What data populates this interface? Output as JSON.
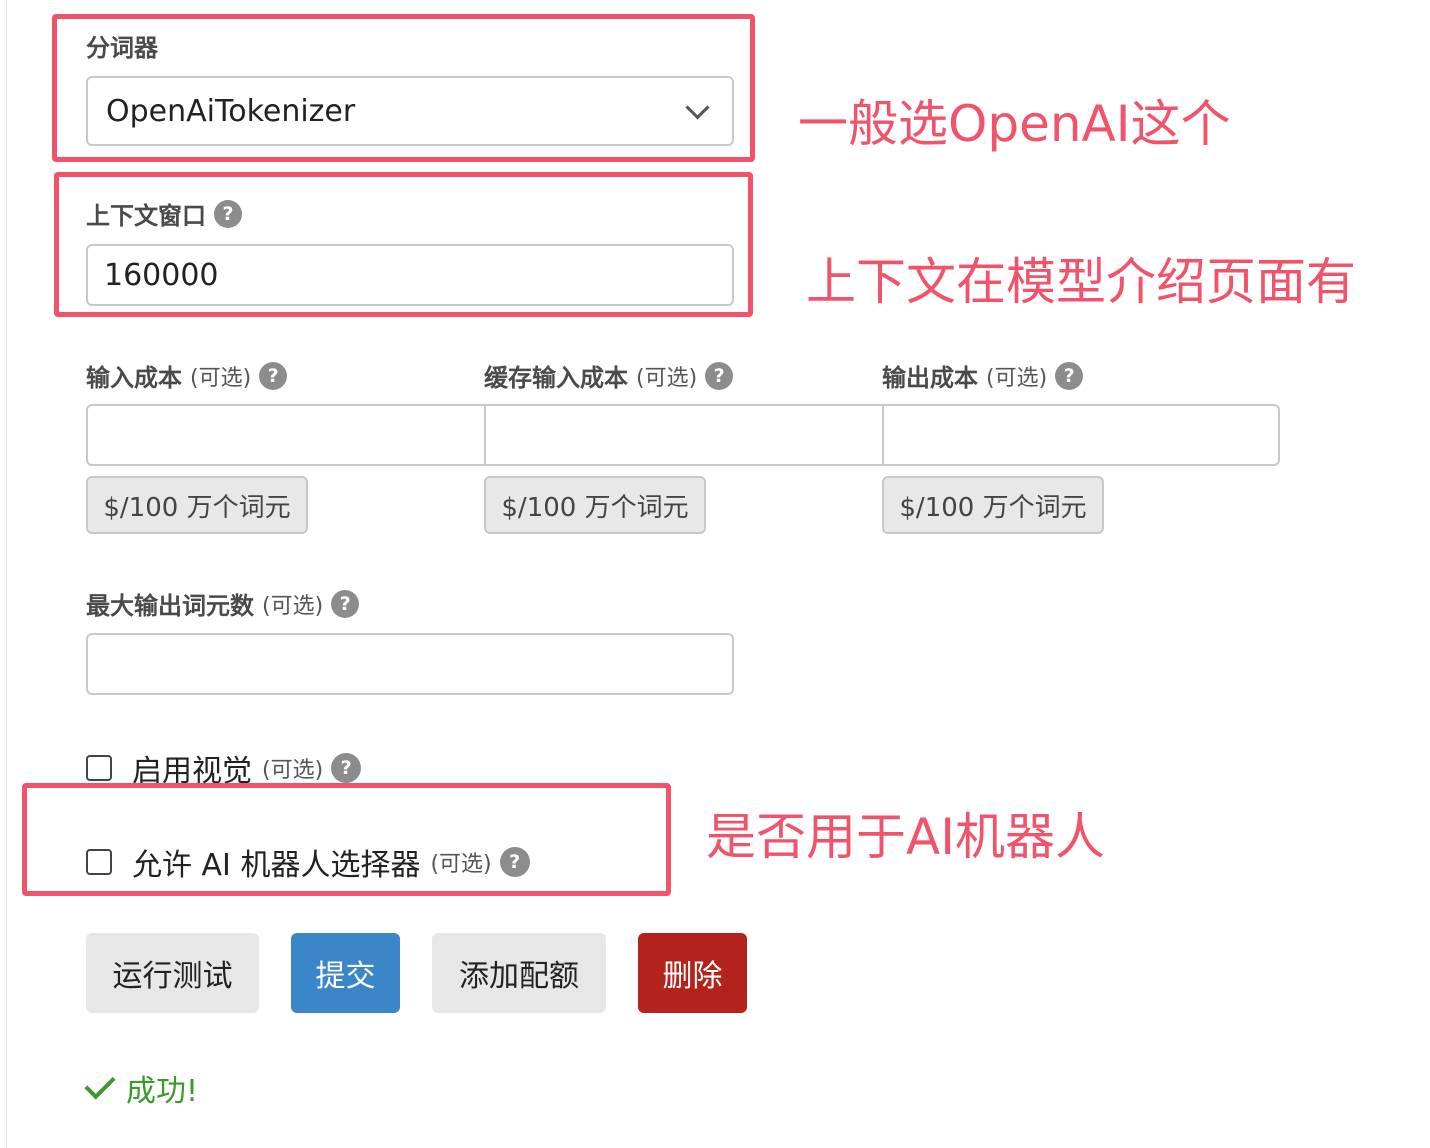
{
  "tokenizer": {
    "label": "分词器",
    "value": "OpenAiTokenizer"
  },
  "context_window": {
    "label": "上下文窗口",
    "value": "160000"
  },
  "costs": [
    {
      "label": "输入成本",
      "optional": "(可选)",
      "value": "",
      "unit": "$/100 万个词元"
    },
    {
      "label": "缓存输入成本",
      "optional": "(可选)",
      "value": "",
      "unit": "$/100 万个词元"
    },
    {
      "label": "输出成本",
      "optional": "(可选)",
      "value": "",
      "unit": "$/100 万个词元"
    }
  ],
  "max_output_tokens": {
    "label": "最大输出词元数",
    "optional": "(可选)",
    "value": ""
  },
  "checkboxes": {
    "vision": {
      "label": "启用视觉",
      "optional": "(可选)",
      "checked": false
    },
    "ai_bot": {
      "label": "允许 AI 机器人选择器",
      "optional": "(可选)",
      "checked": false
    }
  },
  "buttons": {
    "run_test": "运行测试",
    "submit": "提交",
    "add_quota": "添加配额",
    "delete": "删除"
  },
  "status": {
    "message": "成功!"
  },
  "help_icon": "?",
  "annotations": {
    "tokenizer_note": "一般选OpenAI这个",
    "context_note": "上下文在模型介绍页面有",
    "ai_bot_note": "是否用于AI机器人"
  },
  "colors": {
    "annotation": "#f0536a",
    "primary": "#3a86c9",
    "danger": "#b3221b",
    "success": "#3c9a2c"
  }
}
